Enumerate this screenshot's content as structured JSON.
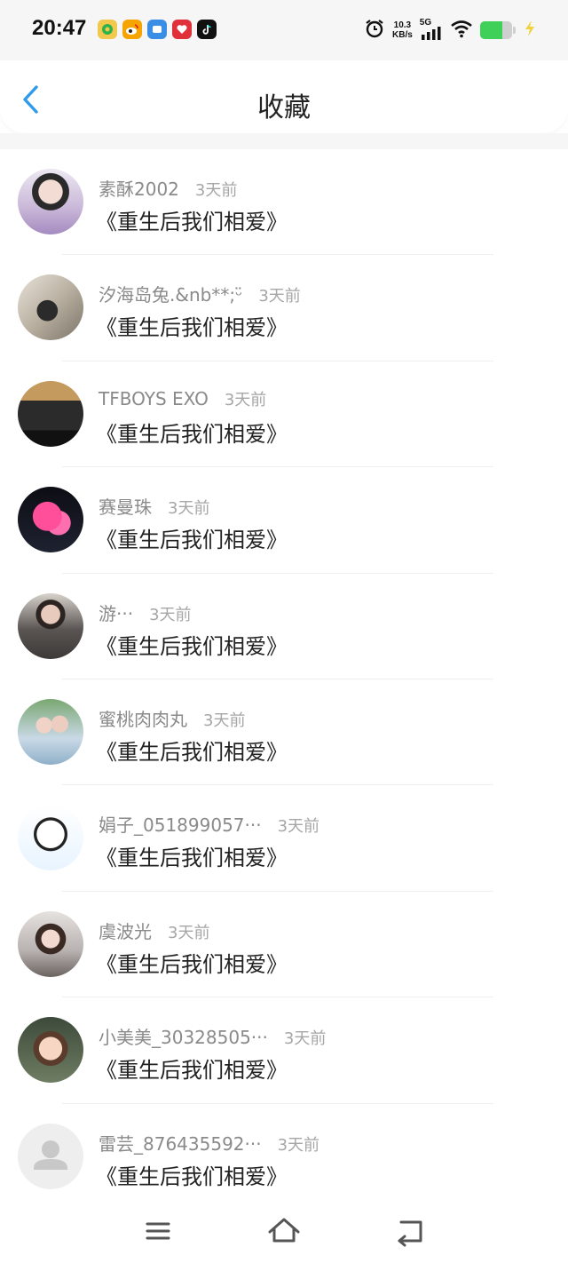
{
  "status_bar": {
    "time": "20:47",
    "app_icons": [
      "qq-music-icon",
      "weibo-icon",
      "app-icon",
      "heart-app-icon",
      "tiktok-icon"
    ],
    "net_speed_value": "10.3",
    "net_speed_unit": "KB/s",
    "network": "5G",
    "battery_level": 0.7
  },
  "header": {
    "title": "收藏"
  },
  "favorites": [
    {
      "user": "素酥2002",
      "time": "3天前",
      "title": "《重生后我们相爱》"
    },
    {
      "user": "汐海岛兔.&nb**;ᵕ̈",
      "time": "3天前",
      "title": "《重生后我们相爱》"
    },
    {
      "user": "TFBOYS EXO",
      "time": "3天前",
      "title": "《重生后我们相爱》"
    },
    {
      "user": "赛曼珠",
      "time": "3天前",
      "title": "《重生后我们相爱》"
    },
    {
      "user": "游···",
      "time": "3天前",
      "title": "《重生后我们相爱》"
    },
    {
      "user": "蜜桃肉肉丸",
      "time": "3天前",
      "title": "《重生后我们相爱》"
    },
    {
      "user": "娟子_051899057···",
      "time": "3天前",
      "title": "《重生后我们相爱》"
    },
    {
      "user": "虞波光",
      "time": "3天前",
      "title": "《重生后我们相爱》"
    },
    {
      "user": "小美美_30328505···",
      "time": "3天前",
      "title": "《重生后我们相爱》"
    },
    {
      "user": "雷芸_876435592···",
      "time": "3天前",
      "title": "《重生后我们相爱》"
    }
  ],
  "colors": {
    "accent": "#2f9bea",
    "battery": "#3fd05a"
  }
}
